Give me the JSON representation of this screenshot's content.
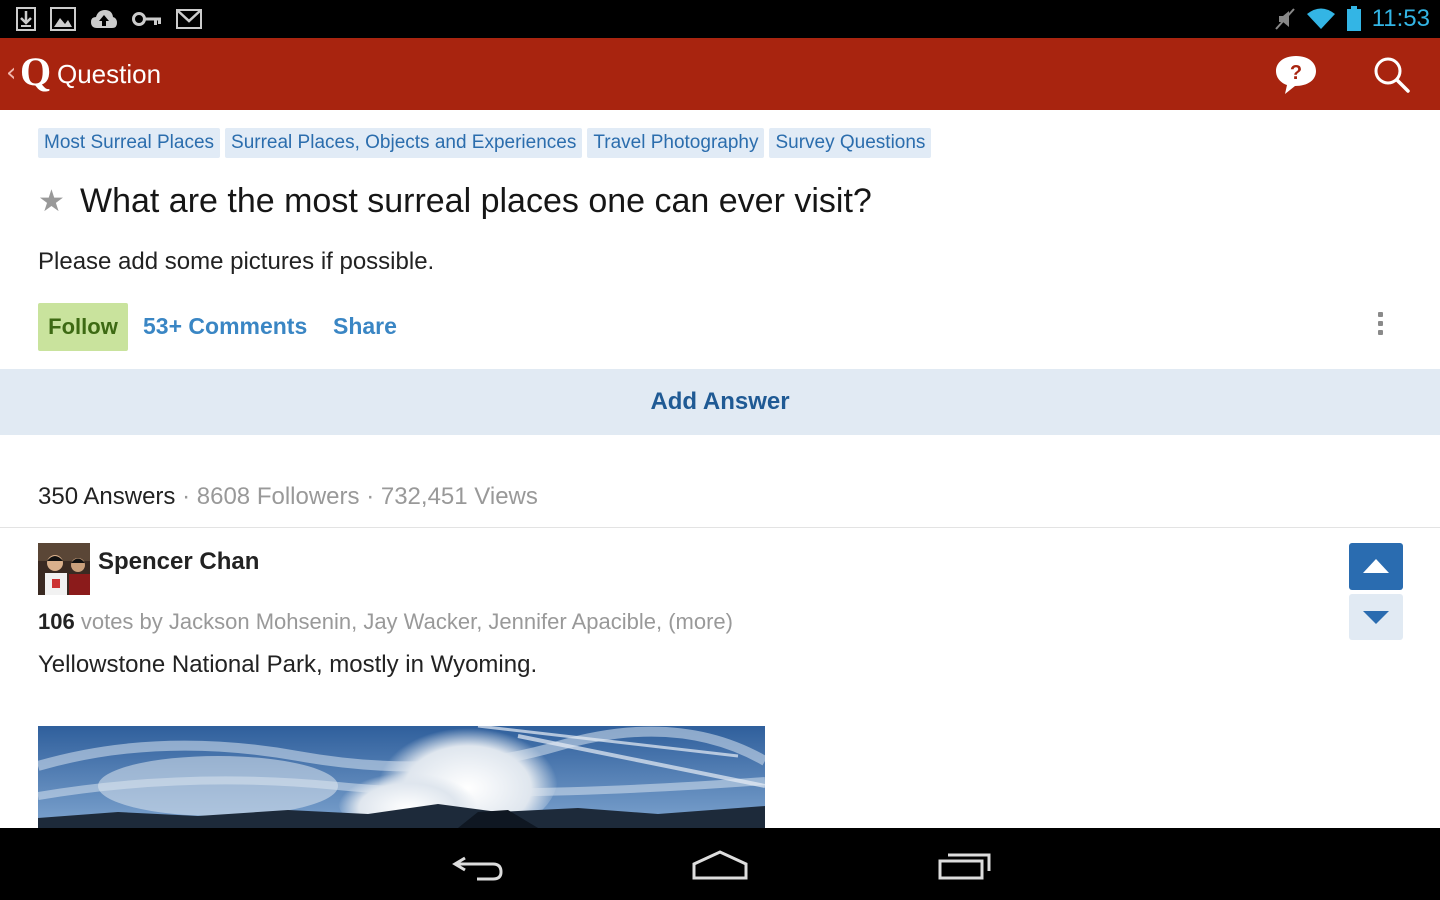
{
  "status_bar": {
    "time": "11:53",
    "left_icons": [
      "download-icon",
      "image-icon",
      "cloud-upload-icon",
      "key-icon",
      "gmail-icon"
    ],
    "right_icons": [
      "mute-icon",
      "wifi-icon",
      "battery-icon"
    ],
    "time_color": "#33b5e5"
  },
  "action_bar": {
    "logo": "Q",
    "title": "Question",
    "background": "#a8240f",
    "help_icon": "question-bubble-icon",
    "search_icon": "search-icon"
  },
  "topics": [
    "Most Surreal Places",
    "Surreal Places, Objects and Experiences",
    "Travel Photography",
    "Survey Questions"
  ],
  "question": {
    "title": "What are the most surreal places one can ever visit?",
    "details": "Please add some pictures if possible."
  },
  "actions": {
    "follow_label": "Follow",
    "comments_label": "53+ Comments",
    "share_label": "Share",
    "add_answer_label": "Add Answer"
  },
  "stats": {
    "answers": "350 Answers",
    "followers": "8608 Followers",
    "views": "732,451 Views"
  },
  "answer": {
    "author": "Spencer Chan",
    "vote_count": "106",
    "votes_text": "votes by Jackson Mohsenin, Jay Wacker, Jennifer Apacible, (more)",
    "text": "Yellowstone National Park, mostly in Wyoming."
  },
  "colors": {
    "accent_blue": "#2a6cb0",
    "link_blue": "#3a86c4",
    "follow_green": "#c9e39d",
    "topic_bg": "#e1ebf6"
  }
}
